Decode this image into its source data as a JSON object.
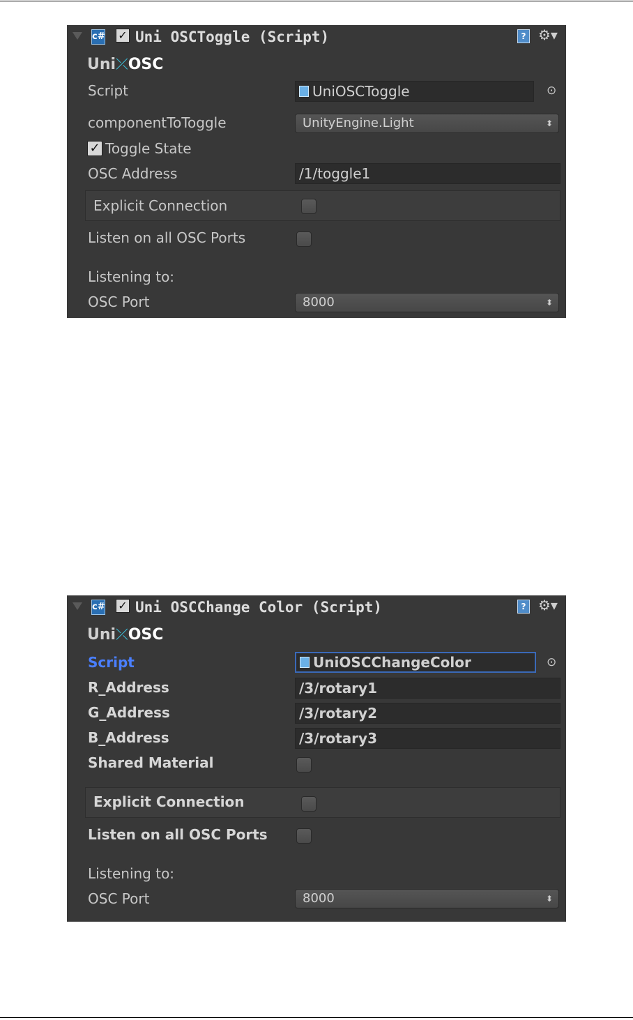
{
  "panels": [
    {
      "header_title": "Uni OSCToggle (Script)",
      "header_enabled": true,
      "logo": {
        "uni": "Uni",
        "mark": "⤫",
        "osc": "OSC"
      },
      "fields": {
        "script_label": "Script",
        "script_value": "UniOSCToggle",
        "component_label": "componentToToggle",
        "component_value": "UnityEngine.Light",
        "toggle_state_label": "Toggle State",
        "toggle_state_checked": true,
        "osc_address_label": "OSC Address",
        "osc_address_value": "/1/toggle1",
        "explicit_connection_label": "Explicit Connection",
        "explicit_connection_checked": false,
        "listen_all_label": "Listen on all OSC Ports",
        "listen_all_checked": false,
        "listening_to_label": "Listening to:",
        "osc_port_label": "OSC Port",
        "osc_port_value": "8000"
      }
    },
    {
      "header_title": "Uni OSCChange Color (Script)",
      "header_enabled": true,
      "logo": {
        "uni": "Uni",
        "mark": "⤫",
        "osc": "OSC"
      },
      "fields": {
        "script_label": "Script",
        "script_value": "UniOSCChangeColor",
        "r_label": "R_Address",
        "r_value": "/3/rotary1",
        "g_label": "G_Address",
        "g_value": "/3/rotary2",
        "b_label": "B_Address",
        "b_value": "/3/rotary3",
        "shared_material_label": "Shared Material",
        "shared_material_checked": false,
        "explicit_connection_label": "Explicit Connection",
        "explicit_connection_checked": false,
        "listen_all_label": "Listen on all OSC Ports",
        "listen_all_checked": false,
        "listening_to_label": "Listening to:",
        "osc_port_label": "OSC Port",
        "osc_port_value": "8000"
      }
    }
  ],
  "glyphs": {
    "check": "✓",
    "target": "⊙",
    "popup_arrows": "⬍",
    "gear": "⚙▾",
    "help": "?",
    "cs": "c#"
  },
  "colors": {
    "panel_bg": "#383838",
    "highlight_label": "#4a7fff",
    "selection_border": "#3a69b8"
  }
}
